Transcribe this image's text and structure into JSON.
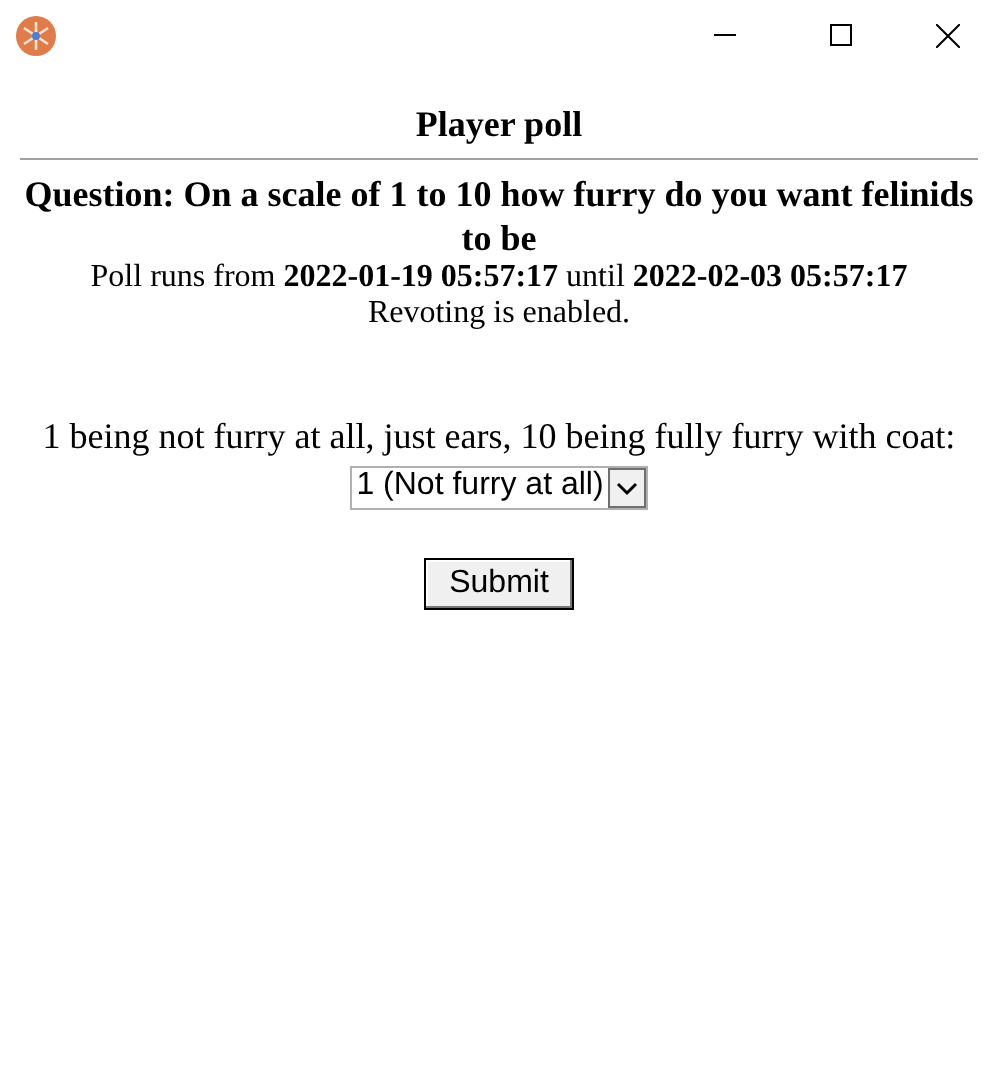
{
  "window": {
    "title": "Player poll"
  },
  "poll": {
    "question": "Question: On a scale of 1 to 10 how furry do you want felinids to be",
    "period": "Poll runs from **2022-01-19 05:57:17** until **2022-02-03 05:57:17**",
    "note": "Revoting is enabled.",
    "prompt": "1 being not furry at all, just ears, 10 being fully furry with coat:",
    "dropdown": {
      "value": "1 (Not furry at all)"
    },
    "submit": "Submit"
  }
}
